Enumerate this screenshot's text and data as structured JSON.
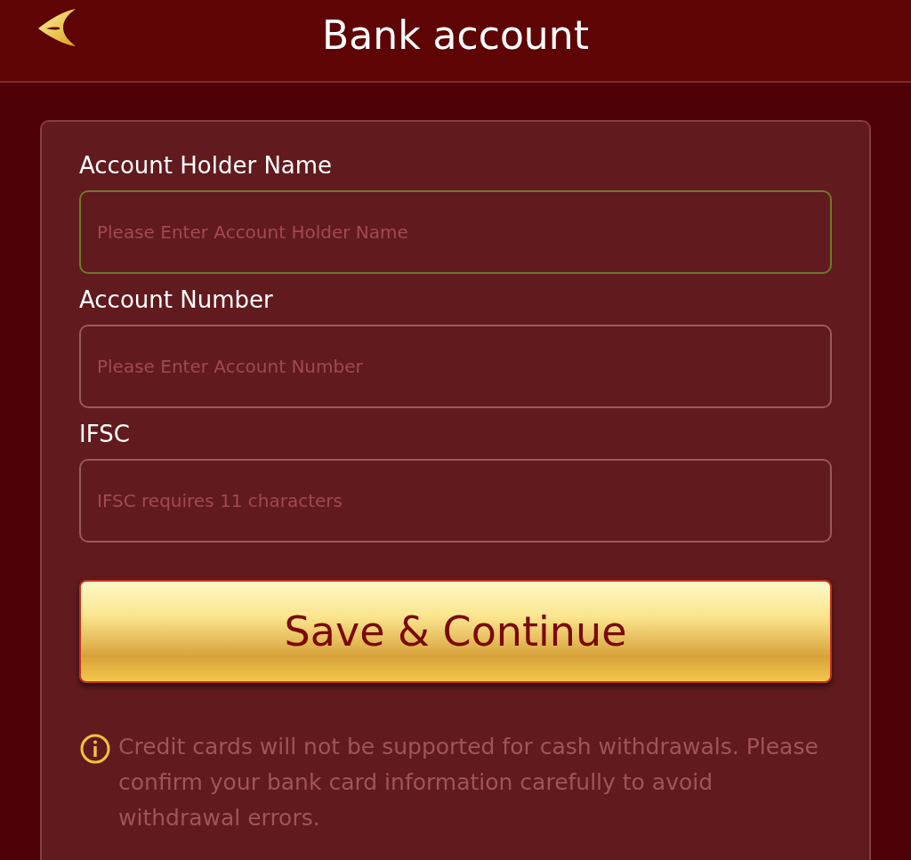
{
  "header": {
    "title": "Bank account"
  },
  "fields": [
    {
      "label": "Account Holder Name",
      "placeholder": "Please Enter Account Holder Name",
      "focused": true
    },
    {
      "label": "Account Number",
      "placeholder": "Please Enter Account Number",
      "focused": false
    },
    {
      "label": "IFSC",
      "placeholder": "IFSC requires 11 characters",
      "focused": false
    }
  ],
  "submit_button": "Save & Continue",
  "notice": "Credit cards will not be supported for cash withdrawals. Please confirm your bank card information carefully to avoid withdrawal errors."
}
